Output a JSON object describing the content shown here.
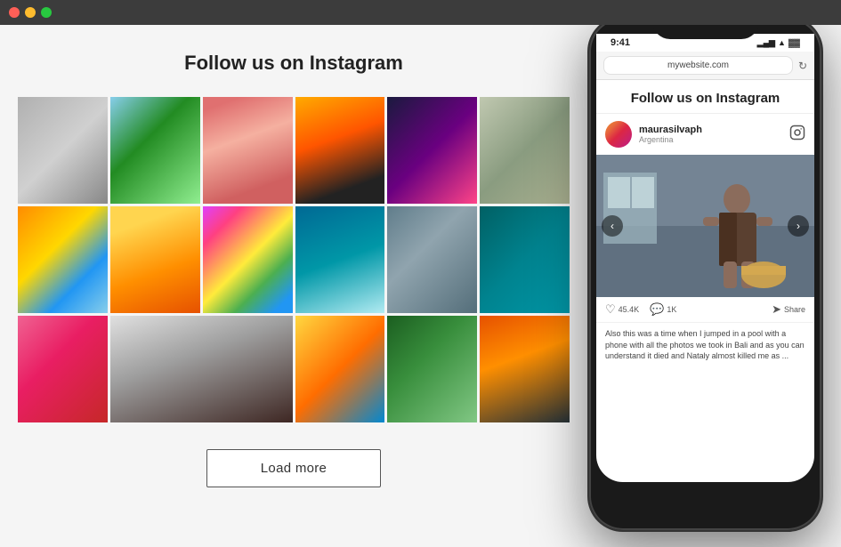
{
  "titlebar": {
    "buttons": [
      "close",
      "minimize",
      "maximize"
    ]
  },
  "header": {
    "title": "Follow us on Instagram"
  },
  "grid": {
    "images": [
      {
        "id": 1,
        "class": "img-1",
        "span": false
      },
      {
        "id": 2,
        "class": "img-2",
        "span": false
      },
      {
        "id": 3,
        "class": "img-3",
        "span": false
      },
      {
        "id": 4,
        "class": "img-4",
        "span": false
      },
      {
        "id": 5,
        "class": "img-5",
        "span": false
      },
      {
        "id": 6,
        "class": "img-6",
        "span": false
      },
      {
        "id": 7,
        "class": "img-7",
        "span": false
      },
      {
        "id": 8,
        "class": "img-8",
        "span": false
      },
      {
        "id": 9,
        "class": "img-9",
        "span": false
      },
      {
        "id": 10,
        "class": "img-10",
        "span": false
      },
      {
        "id": 11,
        "class": "img-11",
        "span": false
      },
      {
        "id": 12,
        "class": "img-12",
        "span": false
      },
      {
        "id": 13,
        "class": "img-13",
        "span": false
      },
      {
        "id": 14,
        "class": "img-14",
        "span": true
      },
      {
        "id": 15,
        "class": "img-15",
        "span": false
      },
      {
        "id": 16,
        "class": "img-16",
        "span": false
      },
      {
        "id": 17,
        "class": "img-17",
        "span": false
      }
    ]
  },
  "loadmore": {
    "label": "Load more"
  },
  "phone": {
    "status_time": "9:41",
    "url": "mywebsite.com",
    "title": "Follow us on Instagram",
    "post": {
      "username": "maurasilvaph",
      "location": "Argentina",
      "likes": "45.4K",
      "comments": "1K",
      "share_label": "Share",
      "caption": "Also this was a time when I jumped in a pool with a phone with all the photos we took in Bali and as you can understand it died and Nataly almost killed me as ..."
    },
    "prev_arrow": "‹",
    "next_arrow": "›"
  }
}
